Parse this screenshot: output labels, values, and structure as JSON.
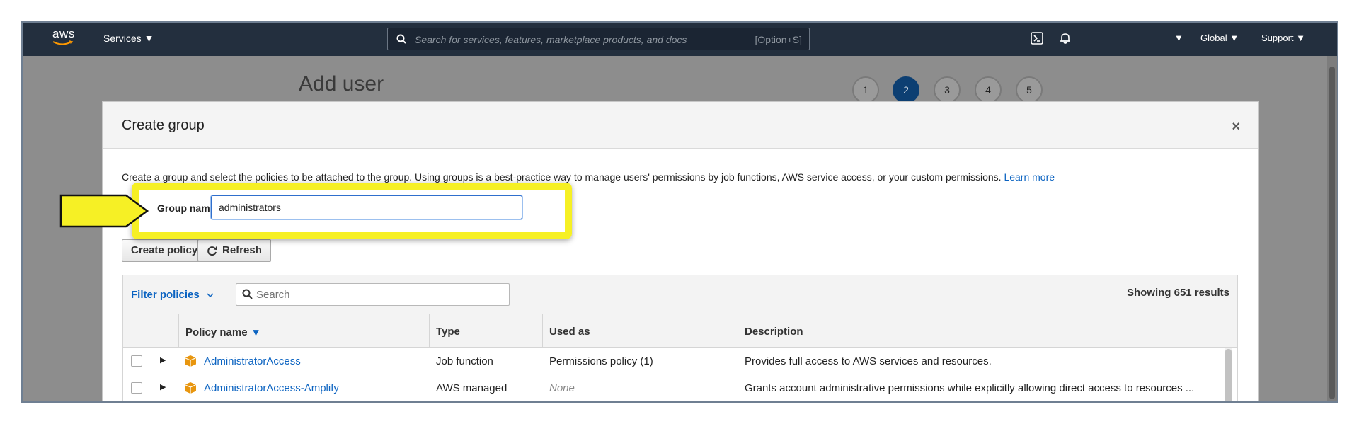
{
  "nav": {
    "logo_text": "aws",
    "services_label": "Services ▼",
    "search_placeholder": "Search for services, features, marketplace products, and docs",
    "search_shortcut": "[Option+S]",
    "account_caret": "▼",
    "region_label": "Global ▼",
    "support_label": "Support ▼"
  },
  "page": {
    "title": "Add user",
    "steps": [
      "1",
      "2",
      "3",
      "4",
      "5"
    ],
    "active_step": 2
  },
  "modal": {
    "title": "Create group",
    "close_glyph": "×",
    "intro": "Create a group and select the policies to be attached to the group. Using groups is a best-practice way to manage users' permissions by job functions, AWS service access, or your custom permissions.",
    "learn_more": "Learn more",
    "group_name_label": "Group name",
    "group_name_value": "administrators",
    "create_policy_label": "Create policy",
    "refresh_label": "Refresh"
  },
  "table": {
    "filter_label": "Filter policies",
    "search_placeholder": "Search",
    "showing": "Showing 651 results",
    "columns": [
      "Policy name",
      "Type",
      "Used as",
      "Description"
    ],
    "sort_indicator": "▾",
    "rows": [
      {
        "name": "AdministratorAccess",
        "type": "Job function",
        "used_as": "Permissions policy (1)",
        "description": "Provides full access to AWS services and resources."
      },
      {
        "name": "AdministratorAccess-Amplify",
        "type": "AWS managed",
        "used_as": "None",
        "description": "Grants account administrative permissions while explicitly allowing direct access to resources ..."
      }
    ]
  },
  "colors": {
    "nav_bg": "#232f3e",
    "link": "#0b63c1",
    "callout": "#f6f025",
    "active_step": "#0d3f72"
  }
}
